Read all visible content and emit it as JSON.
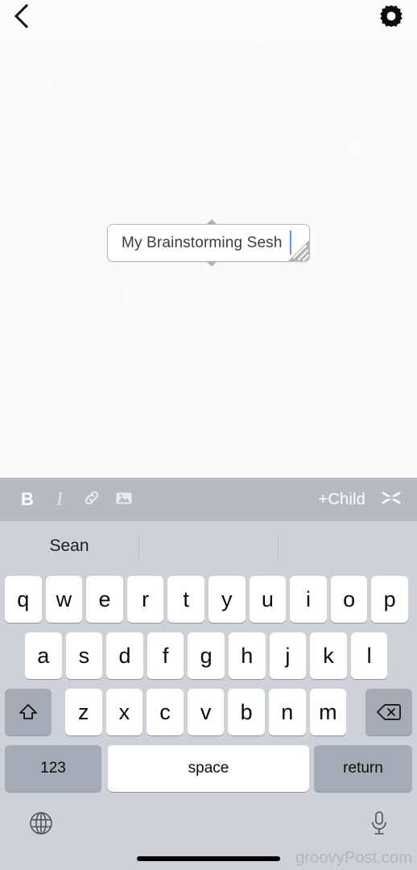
{
  "topbar": {
    "back_icon": "chevron-left-icon",
    "settings_icon": "gear-icon"
  },
  "canvas": {
    "background_color": "#fafafa",
    "node": {
      "text": "My Brainstorming Sesh",
      "caret_color": "#5a9bf0",
      "border_color": "#b9b9b9",
      "resize_handle_icon": "resize-corner-icon",
      "connector_top_icon": "triangle-up-nub",
      "connector_bottom_icon": "triangle-down-nub"
    }
  },
  "format_toolbar": {
    "background_color": "#b6bac4",
    "bold_label": "B",
    "italic_label": "I",
    "link_icon": "link-chain-icon",
    "image_icon": "image-picture-icon",
    "add_child_label": "+Child",
    "cut_icon": "scissors-cut-icon"
  },
  "keyboard": {
    "background_color": "#ced2d8",
    "predictions": [
      "Sean",
      "",
      ""
    ],
    "row1": [
      "q",
      "w",
      "e",
      "r",
      "t",
      "y",
      "u",
      "i",
      "o",
      "p"
    ],
    "row2": [
      "a",
      "s",
      "d",
      "f",
      "g",
      "h",
      "j",
      "k",
      "l"
    ],
    "row3": [
      "z",
      "x",
      "c",
      "v",
      "b",
      "n",
      "m"
    ],
    "shift_icon": "shift-arrow-icon",
    "backspace_icon": "backspace-delete-icon",
    "numbers_label": "123",
    "space_label": "space",
    "return_label": "return",
    "globe_icon": "globe-language-icon",
    "mic_icon": "microphone-icon"
  },
  "watermark": {
    "text": "groovyPost.com"
  }
}
